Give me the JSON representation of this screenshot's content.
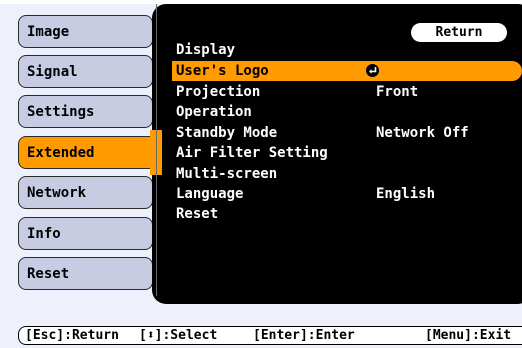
{
  "left_menu": {
    "items": [
      {
        "label": "Image",
        "active": false
      },
      {
        "label": "Signal",
        "active": false
      },
      {
        "label": "Settings",
        "active": false
      },
      {
        "label": "Extended",
        "active": true
      },
      {
        "label": "Network",
        "active": false
      },
      {
        "label": "Info",
        "active": false
      },
      {
        "label": "Reset",
        "active": false
      }
    ]
  },
  "panel": {
    "return_label": "Return",
    "rows": [
      {
        "label": "Display",
        "value": ""
      },
      {
        "label": "User's Logo",
        "value": "",
        "selected": true,
        "icon": "enter-icon"
      },
      {
        "label": "Projection",
        "value": "Front"
      },
      {
        "label": "Operation",
        "value": ""
      },
      {
        "label": "Standby Mode",
        "value": "Network Off"
      },
      {
        "label": "Air Filter Setting",
        "value": ""
      },
      {
        "label": "Multi-screen",
        "value": ""
      },
      {
        "label": "Language",
        "value": "English"
      },
      {
        "label": "Reset",
        "value": ""
      }
    ]
  },
  "footer": {
    "esc": "[Esc]:Return",
    "select": "[⬍]:Select",
    "enter": "[Enter]:Enter",
    "menu": "[Menu]:Exit"
  },
  "colors": {
    "accent": "#ff9a00",
    "panel": "#000000",
    "menu_item": "#c8cce2"
  }
}
